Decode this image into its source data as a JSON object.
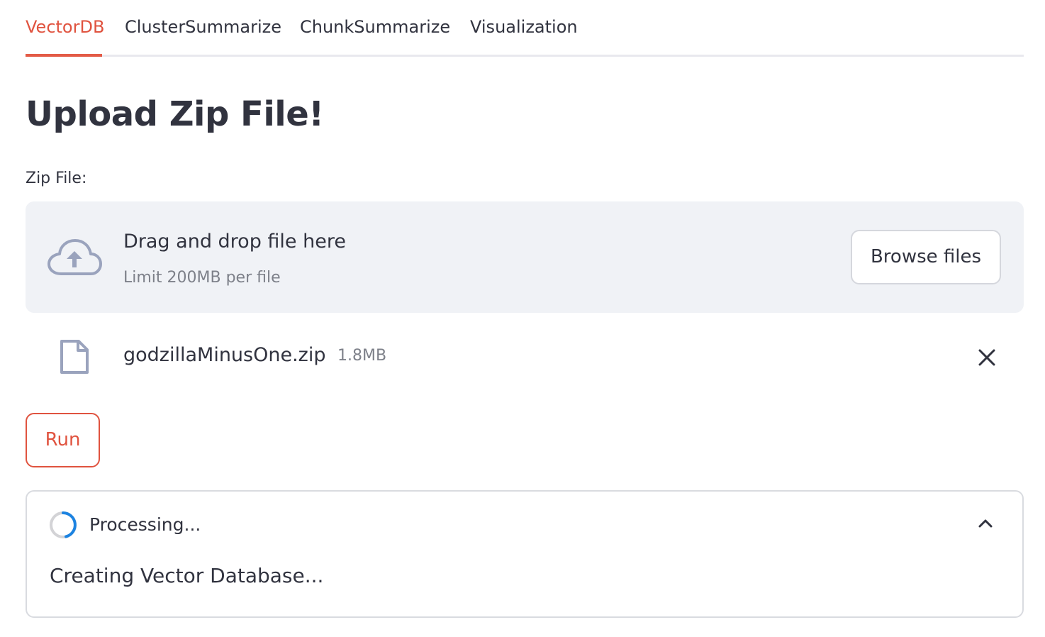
{
  "tabs": [
    {
      "label": "VectorDB",
      "active": true
    },
    {
      "label": "ClusterSummarize",
      "active": false
    },
    {
      "label": "ChunkSummarize",
      "active": false
    },
    {
      "label": "Visualization",
      "active": false
    }
  ],
  "page": {
    "title": "Upload Zip File!"
  },
  "uploader": {
    "label": "Zip File:",
    "drop_text": "Drag and drop file here",
    "limit_text": "Limit 200MB per file",
    "browse_label": "Browse files",
    "upload_icon": "cloud-upload-icon"
  },
  "uploaded_file": {
    "name": "godzillaMinusOne.zip",
    "size": "1.8MB",
    "icon": "file-icon",
    "remove_icon": "close-icon"
  },
  "actions": {
    "run_label": "Run"
  },
  "status": {
    "title": "Processing...",
    "message": "Creating Vector Database...",
    "expanded": true
  },
  "colors": {
    "accent": "#e0533f",
    "text": "#31333f",
    "muted": "#7d8089",
    "dropzone_bg": "#f0f2f6",
    "spinner_blue": "#1c83e1"
  }
}
